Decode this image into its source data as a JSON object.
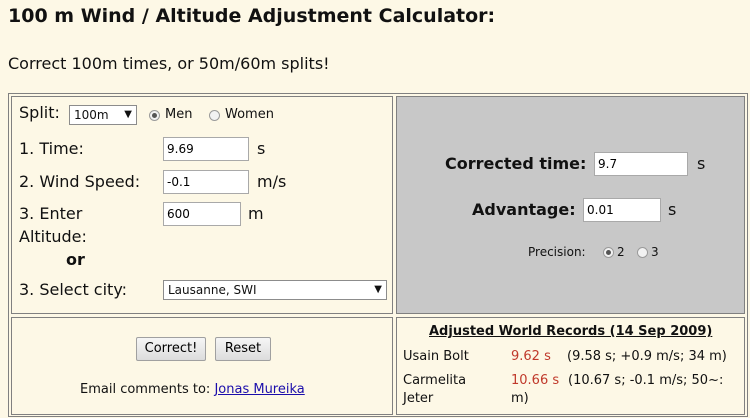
{
  "title": "100 m Wind / Altitude Adjustment Calculator:",
  "subtitle": "Correct 100m times, or 50m/60m splits!",
  "inputs": {
    "split_label": "Split:",
    "split_value": "100m",
    "gender_options": [
      "Men",
      "Women"
    ],
    "gender_selected": "Men",
    "time_label": "1. Time:",
    "time_value": "9.69",
    "time_unit": "s",
    "wind_label": "2. Wind Speed:",
    "wind_value": "-0.1",
    "wind_unit": "m/s",
    "altitude_label_line1": "3. Enter",
    "altitude_label_line2": "Altitude:",
    "altitude_value": "600",
    "altitude_unit": "m",
    "or_label": "or",
    "city_label": "3. Select city:",
    "city_value": "Lausanne, SWI"
  },
  "results": {
    "corrected_label": "Corrected time:",
    "corrected_value": "9.7",
    "corrected_unit": "s",
    "advantage_label": "Advantage:",
    "advantage_value": "0.01",
    "advantage_unit": "s",
    "precision_label": "Precision:",
    "precision_options": [
      "2",
      "3"
    ],
    "precision_selected": "2"
  },
  "buttons": {
    "correct_label": "Correct!",
    "reset_label": "Reset"
  },
  "footer": {
    "email_prefix": "Email comments to:",
    "email_link": "Jonas Mureika"
  },
  "records": {
    "header": "Adjusted World Records (14 Sep 2009)",
    "rows": [
      {
        "name": "Usain Bolt",
        "time": "9.62 s",
        "detail": "(9.58 s; +0.9 m/s; 34 m)"
      },
      {
        "name_line1": "Carmelita",
        "name_line2": "Jeter",
        "time": "10.66 s",
        "detail_line1": "(10.67 s; -0.1 m/s; 50~:",
        "detail_line2": "m)"
      }
    ]
  },
  "colors": {
    "page_background": "#fdf8e6",
    "result_panel": "#c8c8c8",
    "record_time": "#c0392b",
    "link": "#1a0dab"
  }
}
